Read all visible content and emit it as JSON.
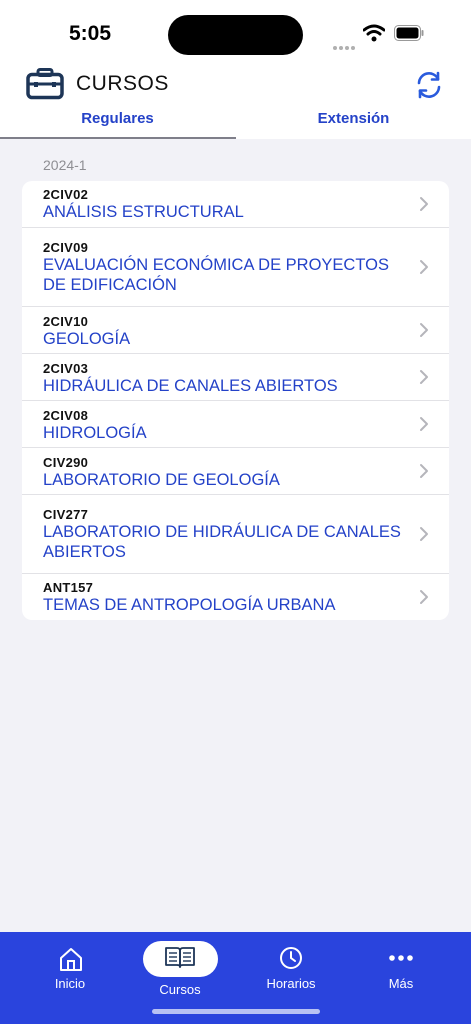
{
  "status": {
    "time": "5:05"
  },
  "header": {
    "title": "CURSOS",
    "icon": "briefcase-icon",
    "refresh_icon": "refresh-icon"
  },
  "tabs": [
    {
      "label": "Regulares",
      "selected": true
    },
    {
      "label": "Extensión",
      "selected": false
    }
  ],
  "term": "2024-1",
  "courses": [
    {
      "code": "2CIV02",
      "name": "ANÁLISIS ESTRUCTURAL"
    },
    {
      "code": "2CIV09",
      "name": "EVALUACIÓN ECONÓMICA DE PROYECTOS DE EDIFICACIÓN"
    },
    {
      "code": "2CIV10",
      "name": "GEOLOGÍA"
    },
    {
      "code": "2CIV03",
      "name": "HIDRÁULICA DE CANALES ABIERTOS"
    },
    {
      "code": "2CIV08",
      "name": "HIDROLOGÍA"
    },
    {
      "code": "CIV290",
      "name": "LABORATORIO DE GEOLOGÍA"
    },
    {
      "code": "CIV277",
      "name": "LABORATORIO DE HIDRÁULICA DE CANALES ABIERTOS"
    },
    {
      "code": "ANT157",
      "name": "TEMAS DE ANTROPOLOGÍA URBANA"
    }
  ],
  "tabbar": [
    {
      "label": "Inicio",
      "icon": "home-icon"
    },
    {
      "label": "Cursos",
      "icon": "book-icon",
      "selected": true
    },
    {
      "label": "Horarios",
      "icon": "clock-icon"
    },
    {
      "label": "Más",
      "icon": "more-dots-icon"
    }
  ],
  "colors": {
    "accent": "#2442c8",
    "tabbar": "#2a44dd",
    "background": "#f2f2f7"
  }
}
